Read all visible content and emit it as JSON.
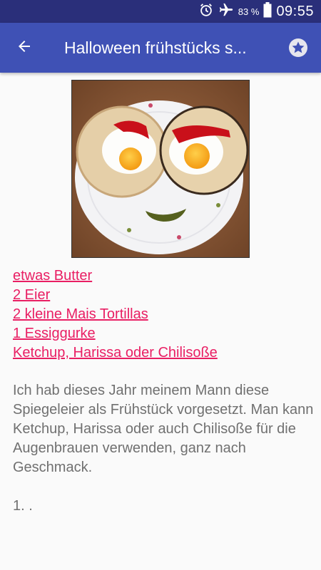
{
  "status": {
    "battery": "83 %",
    "time": "09:55"
  },
  "appbar": {
    "title": "Halloween frühstücks s..."
  },
  "ingredients": [
    "etwas Butter",
    "2 Eier",
    "2 kleine Mais Tortillas",
    "1 Essiggurke",
    "Ketchup, Harissa oder Chilisoße"
  ],
  "description": "Ich hab dieses Jahr meinem Mann diese Spiegeleier als Frühstück vorgesetzt. Man kann Ketchup, Harissa oder auch Chilisoße für die Augenbrauen verwenden, ganz nach Geschmack.",
  "step": "1. .",
  "colors": {
    "statusbar": "#2a2f7a",
    "appbar": "#3f51b5",
    "link": "#e91e63",
    "text": "#707070"
  },
  "icons": [
    "alarm-icon",
    "airplane-icon",
    "battery-icon",
    "back-arrow-icon",
    "star-icon"
  ]
}
